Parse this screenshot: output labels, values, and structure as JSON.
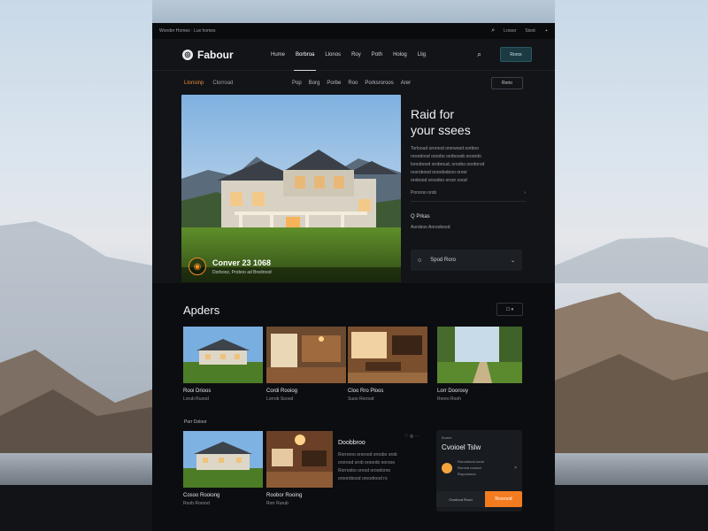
{
  "topbar": {
    "left_text": "Wonder Homes · Lux homes",
    "right_items": [
      "Lrosor",
      "Sioot"
    ],
    "search_icon": "search-icon",
    "bell_icon": "bell-icon"
  },
  "nav": {
    "logo_mark": "◎",
    "logo_text": "Fabour",
    "links": [
      "Hume",
      "Borbroa",
      "Llonos",
      "Roy",
      "Poth",
      "Holog",
      "Llig"
    ],
    "active_index": 1,
    "search_icon": "search-icon",
    "cta": "Rorox"
  },
  "subnav": {
    "left": [
      "Llorisinp",
      "Clorroad"
    ],
    "mid": [
      "Pop",
      "Borg",
      "Porbe",
      "Roo",
      "Porksroroos",
      "Arer"
    ],
    "button": "Rorio"
  },
  "hero": {
    "badge_icon": "◉",
    "title": "Conver 23 1068",
    "subtitle": "Dorbooz, Proboo ad Bredrood"
  },
  "side": {
    "heading_line1": "Raid for",
    "heading_line2": "your ssees",
    "lines": [
      "Torlooud ororood ororwood oorboo",
      "rorordood oroobo oorbooob oroordo",
      "loroobood orobroud, oroobo oordorod",
      "roorobood oroododooo oroor",
      "orobood oroodoo oroor oood"
    ],
    "more_label": "Pororoo orob",
    "price": "Q Prkas",
    "location": "Aoroboo Aoroobood",
    "card_label": "Spod Roro"
  },
  "section": {
    "title": "Apders",
    "control": "☐ ▾",
    "items": [
      {
        "title": "Rooi Drioos",
        "sub": "Lorub Ruood"
      },
      {
        "title": "Cordi Rooiog",
        "sub": "Lorrob Soood"
      },
      {
        "title": "Cloo Rro Ploos",
        "sub": "Suoo Rorood"
      },
      {
        "title": "Lorr Doorooy",
        "sub": "Roreo Rooh"
      }
    ],
    "group_label": "Porr Doloor",
    "items2": [
      {
        "title": "Cosoo Rooiong",
        "sub": "Roob Rorood"
      },
      {
        "title": "Roobor Rooing",
        "sub": "Rorr Rurub"
      }
    ],
    "feature": {
      "title": "Doobbroo",
      "icons": "♡ ◎ ⋯",
      "lines": [
        "Rorroroo ororood oroobo orob",
        "ororood orob oroordo oorooo",
        "Rorroobo orood oroodoroo",
        "oroorobood oroodrood ro"
      ]
    },
    "panel": {
      "kicker": "Boaee",
      "title": "Cvoioel Tslw",
      "row": [
        "Roroobood ooob",
        "Rorood oroood",
        "Ropooloroo"
      ],
      "close": "×",
      "foot_left": "Orodood Rood",
      "foot_right": "Roorood"
    }
  },
  "colors": {
    "accent": "#f47c20",
    "bg": "#121418",
    "cta": "#1b3a42"
  }
}
